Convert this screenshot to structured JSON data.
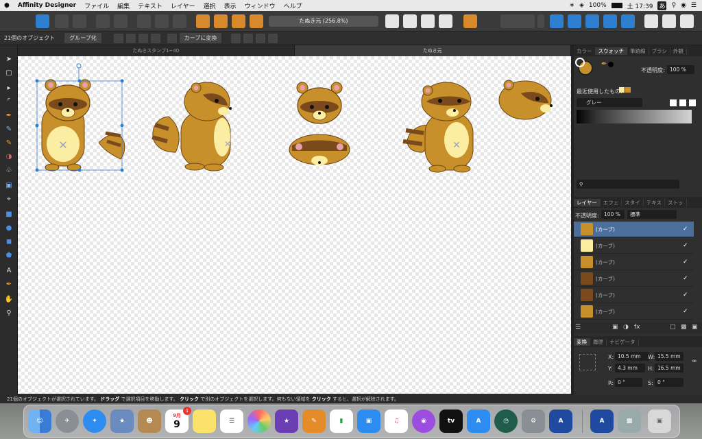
{
  "menubar": {
    "apple": "",
    "app_name": "Affinity Designer",
    "items": [
      "ファイル",
      "編集",
      "テキスト",
      "レイヤー",
      "選択",
      "表示",
      "ウィンドウ",
      "ヘルプ"
    ],
    "battery": "100%",
    "clock": "土 17:39",
    "input": "あ"
  },
  "toolbar": {
    "doc_title": "たぬき元 (256.8%)"
  },
  "context": {
    "selection_count": "21個のオブジェクト",
    "group_button": "グループ化",
    "curve_button": "カーブに変換"
  },
  "tabs": [
    "たぬきスタンプ1~40",
    "たぬき元"
  ],
  "right_panel": {
    "top_tabs": [
      "カラー",
      "スウォッチ",
      "筆跡線",
      "ブラシ",
      "外観"
    ],
    "opacity_label": "不透明度:",
    "opacity_value": "100 %",
    "recent_label": "最近使用したもの:",
    "palette_name": "グレー",
    "layer_tabs": [
      "レイヤー",
      "エフェ",
      "スタイ",
      "テキス",
      "ストッ"
    ],
    "layer_opacity_label": "不透明度:",
    "layer_opacity_value": "100 %",
    "blend_mode": "標準",
    "layers": [
      {
        "name": "(カーブ)",
        "color": "#c8902a",
        "selected": true
      },
      {
        "name": "(カーブ)",
        "color": "#fbeea2",
        "selected": false
      },
      {
        "name": "(カーブ)",
        "color": "#c8902a",
        "selected": false
      },
      {
        "name": "(カーブ)",
        "color": "#7a4a1c",
        "selected": false
      },
      {
        "name": "(カーブ)",
        "color": "#7a4a1c",
        "selected": false
      },
      {
        "name": "(カーブ)",
        "color": "#c8902a",
        "selected": false
      }
    ],
    "transform_tabs": [
      "変換",
      "履歴",
      "ナビゲータ"
    ],
    "transform": {
      "x_label": "X:",
      "x": "10.5 mm",
      "w_label": "W:",
      "w": "15.5 mm",
      "y_label": "Y:",
      "y": "4.3 mm",
      "h_label": "H:",
      "h": "16.5 mm",
      "r_label": "R:",
      "r": "0 °",
      "s_label": "S:",
      "s": "0 °"
    }
  },
  "status": {
    "p1": "21個のオブジェクトが選択されています。",
    "b1": "ドラッグ",
    "p2": "で選択項目を移動します。",
    "b2": "クリック",
    "p3": "で別のオブジェクトを選択します。何もない領域を",
    "b3": "クリック",
    "p4": "すると、選択が解除されます。"
  },
  "dock": {
    "calendar_month": "9月",
    "calendar_day": "9",
    "badge": "1",
    "tv_label": "tv"
  },
  "colors": {
    "accent": "#2f7fd0",
    "tanuki_body": "#c8902a",
    "tanuki_dark": "#7a4a1c",
    "tanuki_belly": "#fbeea2"
  }
}
